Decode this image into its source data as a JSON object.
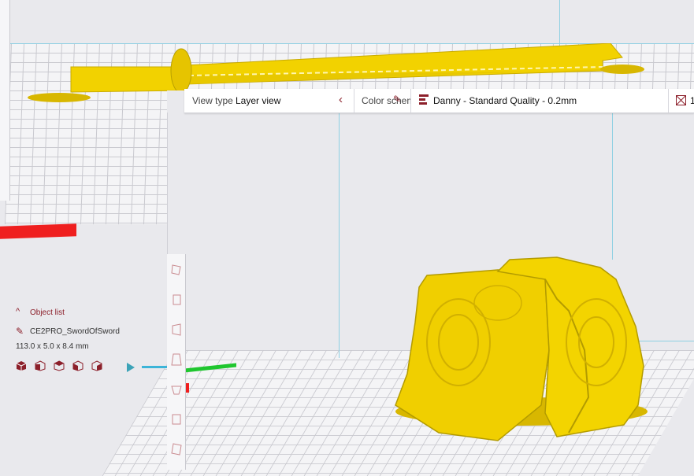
{
  "toolbar": {
    "view_type_label": "View type",
    "view_type_value": "Layer view",
    "color_scheme_label": "Color scheme",
    "profile_value": "Danny - Standard Quality - 0.2mm",
    "right_value": "1"
  },
  "object_list": {
    "header": "Object list",
    "object_name": "CE2PRO_SwordOfSword",
    "dimensions": "113.0 x 5.0 x 8.4 mm"
  },
  "icons": {
    "chevron_left": "chevron-left-icon",
    "chevron_up": "chevron-up-icon",
    "pencil": "pencil-icon",
    "profile": "profile-icon",
    "build_plate": "build-plate-icon",
    "play": "play-icon"
  },
  "colors": {
    "model_yellow": "#f2d200",
    "accent_red": "#ef1f1f",
    "axis_green": "#1fc62f",
    "axis_blue": "#3cb4d8",
    "brand_maroon": "#8c1f2a"
  }
}
